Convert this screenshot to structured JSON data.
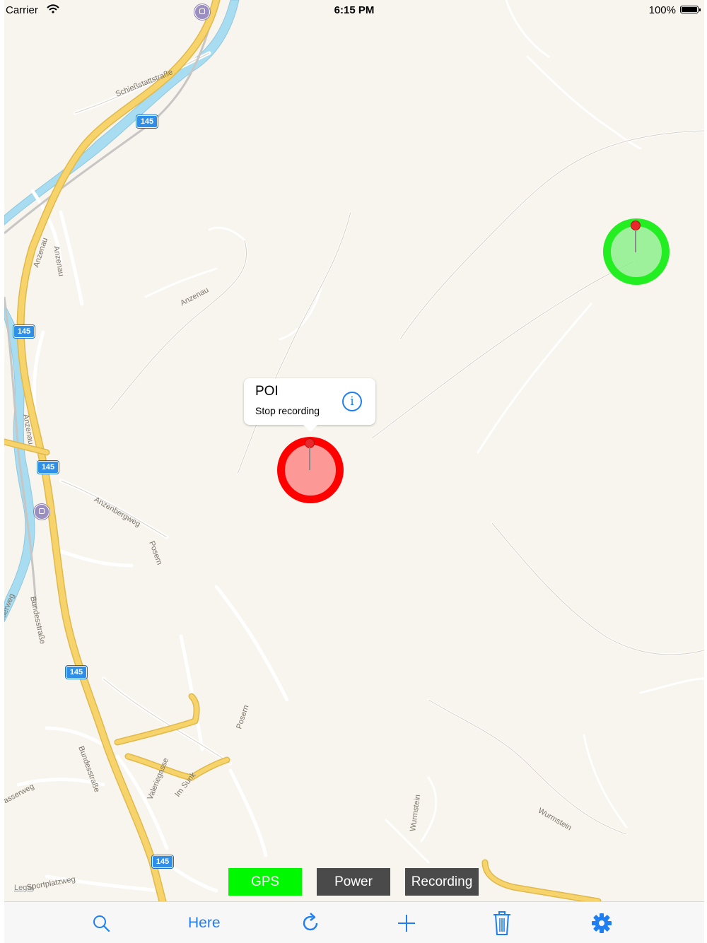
{
  "status_bar": {
    "carrier": "Carrier",
    "time": "6:15 PM",
    "battery": "100%"
  },
  "map": {
    "street_labels": [
      "Schießstattstraße",
      "Anzenau",
      "Anzenau",
      "Anzenau",
      "Anzenau",
      "Anzenbergweg",
      "Posern",
      "Bundesstraße",
      "Bundesstraße",
      "Posern",
      "Valeriegasse",
      "Im Sunk",
      "Wurmstein",
      "Wurmstein",
      "asserweg",
      "asserweg",
      "Sportplatzweg"
    ],
    "route_shields": [
      "145",
      "145",
      "145",
      "145",
      "145"
    ],
    "legal": "Legal",
    "colors": {
      "land": "#f8f4ee",
      "river": "#a8dcf0",
      "major_road": "#f7d36b",
      "minor_road": "#ffffff"
    }
  },
  "markers": {
    "recording_stop": {
      "color": "#ff0000",
      "icon": "pin-icon"
    },
    "recording_start": {
      "color": "#22ee22",
      "icon": "pin-icon"
    }
  },
  "callout": {
    "title": "POI",
    "subtitle": "Stop recording",
    "info_icon": "info-icon"
  },
  "status_buttons": {
    "gps": "GPS",
    "power": "Power",
    "recording": "Recording",
    "gps_color": "#00f800",
    "inactive_color": "#4a4a4a"
  },
  "toolbar": {
    "search_icon": "search-icon",
    "here_label": "Here",
    "refresh_icon": "refresh-icon",
    "add_icon": "plus-icon",
    "delete_icon": "trash-icon",
    "settings_icon": "gear-icon",
    "tint": "#1f7ff1"
  }
}
